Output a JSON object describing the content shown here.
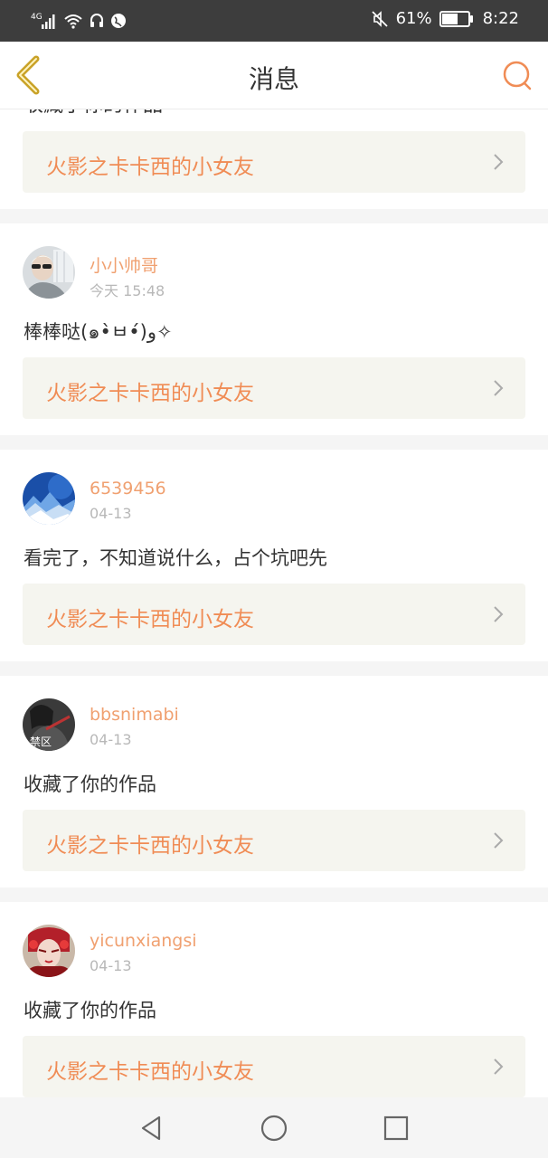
{
  "status_bar": {
    "network": "4G",
    "battery_percent": "61%",
    "battery_level": 0.61,
    "time": "8:22"
  },
  "header": {
    "title": "消息"
  },
  "partial_item": {
    "text": "收藏了你的作品",
    "work_title": "火影之卡卡西的小女友"
  },
  "items": [
    {
      "username": "小小帅哥",
      "time": "今天 15:48",
      "comment": "棒棒哒(๑•̀ㅂ•́)و✧",
      "work_title": "火影之卡卡西的小女友"
    },
    {
      "username": "6539456",
      "time": "04-13",
      "comment": "看完了，不知道说什么，占个坑吧先",
      "work_title": "火影之卡卡西的小女友"
    },
    {
      "username": "bbsnimabi",
      "time": "04-13",
      "comment": "收藏了你的作品",
      "work_title": "火影之卡卡西的小女友",
      "avatar_caption": "禁区"
    },
    {
      "username": "yicunxiangsi",
      "time": "04-13",
      "comment": "收藏了你的作品",
      "work_title": "火影之卡卡西的小女友"
    }
  ],
  "colors": {
    "accent": "#f08c55",
    "username": "#f0a070",
    "back_icon": "#c9a227",
    "status_bar": "#3d3d3d"
  }
}
